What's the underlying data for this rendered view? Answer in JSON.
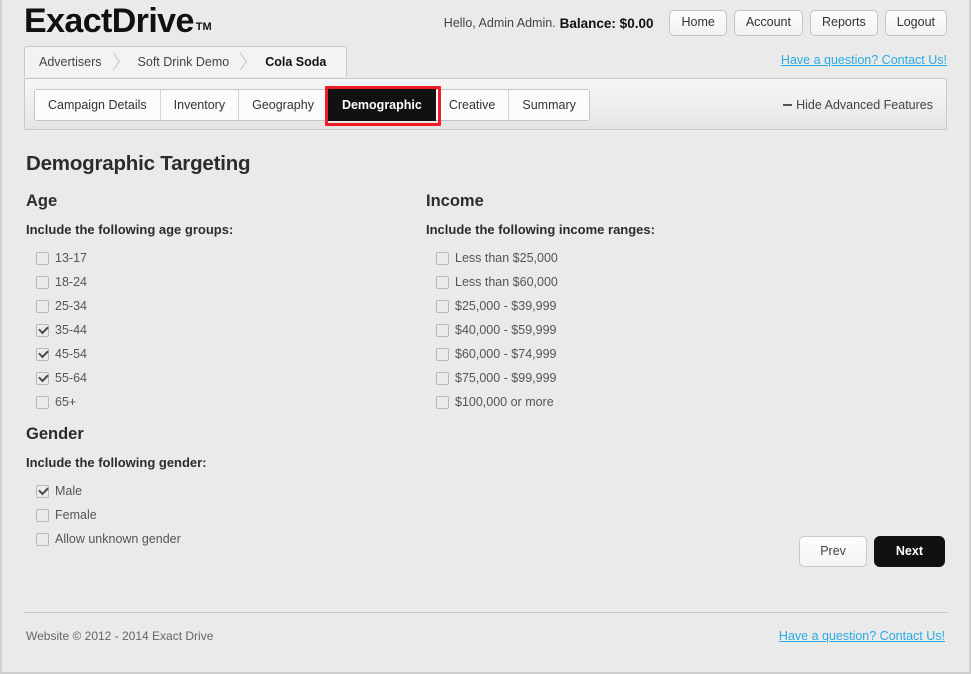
{
  "brand": {
    "name": "ExactDrive",
    "trademark": "TM"
  },
  "header": {
    "greeting": "Hello, Admin Admin.",
    "balance": "Balance: $0.00",
    "nav_buttons": [
      {
        "label": "Home"
      },
      {
        "label": "Account"
      },
      {
        "label": "Reports"
      },
      {
        "label": "Logout"
      }
    ]
  },
  "breadcrumb": {
    "items": [
      {
        "label": "Advertisers"
      },
      {
        "label": "Soft Drink Demo"
      },
      {
        "label": "Cola Soda"
      }
    ],
    "contact_link": "Have a question? Contact Us!"
  },
  "tabs": {
    "items": [
      {
        "label": "Campaign Details",
        "active": false
      },
      {
        "label": "Inventory",
        "active": false
      },
      {
        "label": "Geography",
        "active": false
      },
      {
        "label": "Demographic",
        "active": true
      },
      {
        "label": "Creative",
        "active": false
      },
      {
        "label": "Summary",
        "active": false
      }
    ],
    "advanced_toggle": "Hide Advanced Features",
    "highlight_color": "#ee1c25"
  },
  "main": {
    "page_title": "Demographic Targeting",
    "age": {
      "heading": "Age",
      "instruction": "Include the following age groups:",
      "options": [
        {
          "label": "13-17",
          "checked": false
        },
        {
          "label": "18-24",
          "checked": false
        },
        {
          "label": "25-34",
          "checked": false
        },
        {
          "label": "35-44",
          "checked": true
        },
        {
          "label": "45-54",
          "checked": true
        },
        {
          "label": "55-64",
          "checked": true
        },
        {
          "label": "65+",
          "checked": false
        }
      ]
    },
    "gender": {
      "heading": "Gender",
      "instruction": "Include the following gender:",
      "options": [
        {
          "label": "Male",
          "checked": true
        },
        {
          "label": "Female",
          "checked": false
        },
        {
          "label": "Allow unknown gender",
          "checked": false
        }
      ]
    },
    "income": {
      "heading": "Income",
      "instruction": "Include the following income ranges:",
      "options": [
        {
          "label": "Less than $25,000",
          "checked": false
        },
        {
          "label": "Less than $60,000",
          "checked": false
        },
        {
          "label": "$25,000 - $39,999",
          "checked": false
        },
        {
          "label": "$40,000 - $59,999",
          "checked": false
        },
        {
          "label": "$60,000 - $74,999",
          "checked": false
        },
        {
          "label": "$75,000 - $99,999",
          "checked": false
        },
        {
          "label": "$100,000 or more",
          "checked": false
        }
      ]
    },
    "actions": {
      "prev_label": "Prev",
      "next_label": "Next"
    }
  },
  "footer": {
    "copyright": "Website © 2012 - 2014 Exact Drive",
    "contact_link": "Have a question? Contact Us!"
  },
  "colors": {
    "link": "#29abe2",
    "accent_highlight": "#ee1c25",
    "active_tab_bg": "#111111",
    "page_bg": "#eaeaea"
  }
}
